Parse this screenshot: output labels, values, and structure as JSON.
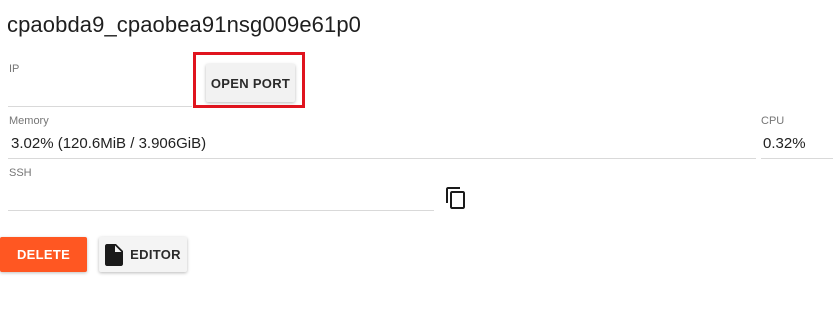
{
  "container": {
    "name": "cpaobda9_cpaobea91nsg009e61p0"
  },
  "ip": {
    "label": "IP",
    "value": "",
    "open_port_label": "OPEN PORT"
  },
  "memory": {
    "label": "Memory",
    "value": "3.02% (120.6MiB / 3.906GiB)"
  },
  "cpu": {
    "label": "CPU",
    "value": "0.32%"
  },
  "ssh": {
    "label": "SSH",
    "value": "",
    "copy_icon": "copy-icon"
  },
  "actions": {
    "delete_label": "DELETE",
    "editor_label": "EDITOR",
    "editor_icon": "file-icon"
  },
  "colors": {
    "delete_button": "#ff5722",
    "highlight_outline": "#e0141e"
  }
}
